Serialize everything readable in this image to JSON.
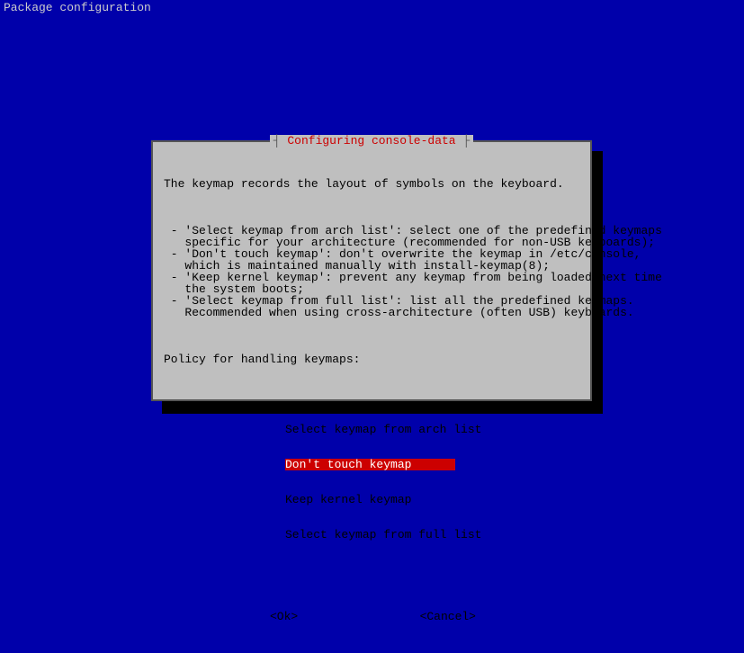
{
  "header": {
    "title": "Package configuration"
  },
  "dialog": {
    "title": "Configuring console-data",
    "intro": "The keymap records the layout of symbols on the keyboard.",
    "bullets_text": " - 'Select keymap from arch list': select one of the predefined keymaps\n   specific for your architecture (recommended for non-USB keyboards);\n - 'Don't touch keymap': don't overwrite the keymap in /etc/console,\n   which is maintained manually with install-keymap(8);\n - 'Keep kernel keymap': prevent any keymap from being loaded next time\n   the system boots;\n - 'Select keymap from full list': list all the predefined keymaps.\n   Recommended when using cross-architecture (often USB) keyboards.",
    "prompt": "Policy for handling keymaps:",
    "options": [
      "Select keymap from arch list",
      "Don't touch keymap",
      "Keep kernel keymap",
      "Select keymap from full list"
    ],
    "selected_index": 1,
    "buttons": {
      "ok": "<Ok>",
      "cancel": "<Cancel>"
    }
  }
}
